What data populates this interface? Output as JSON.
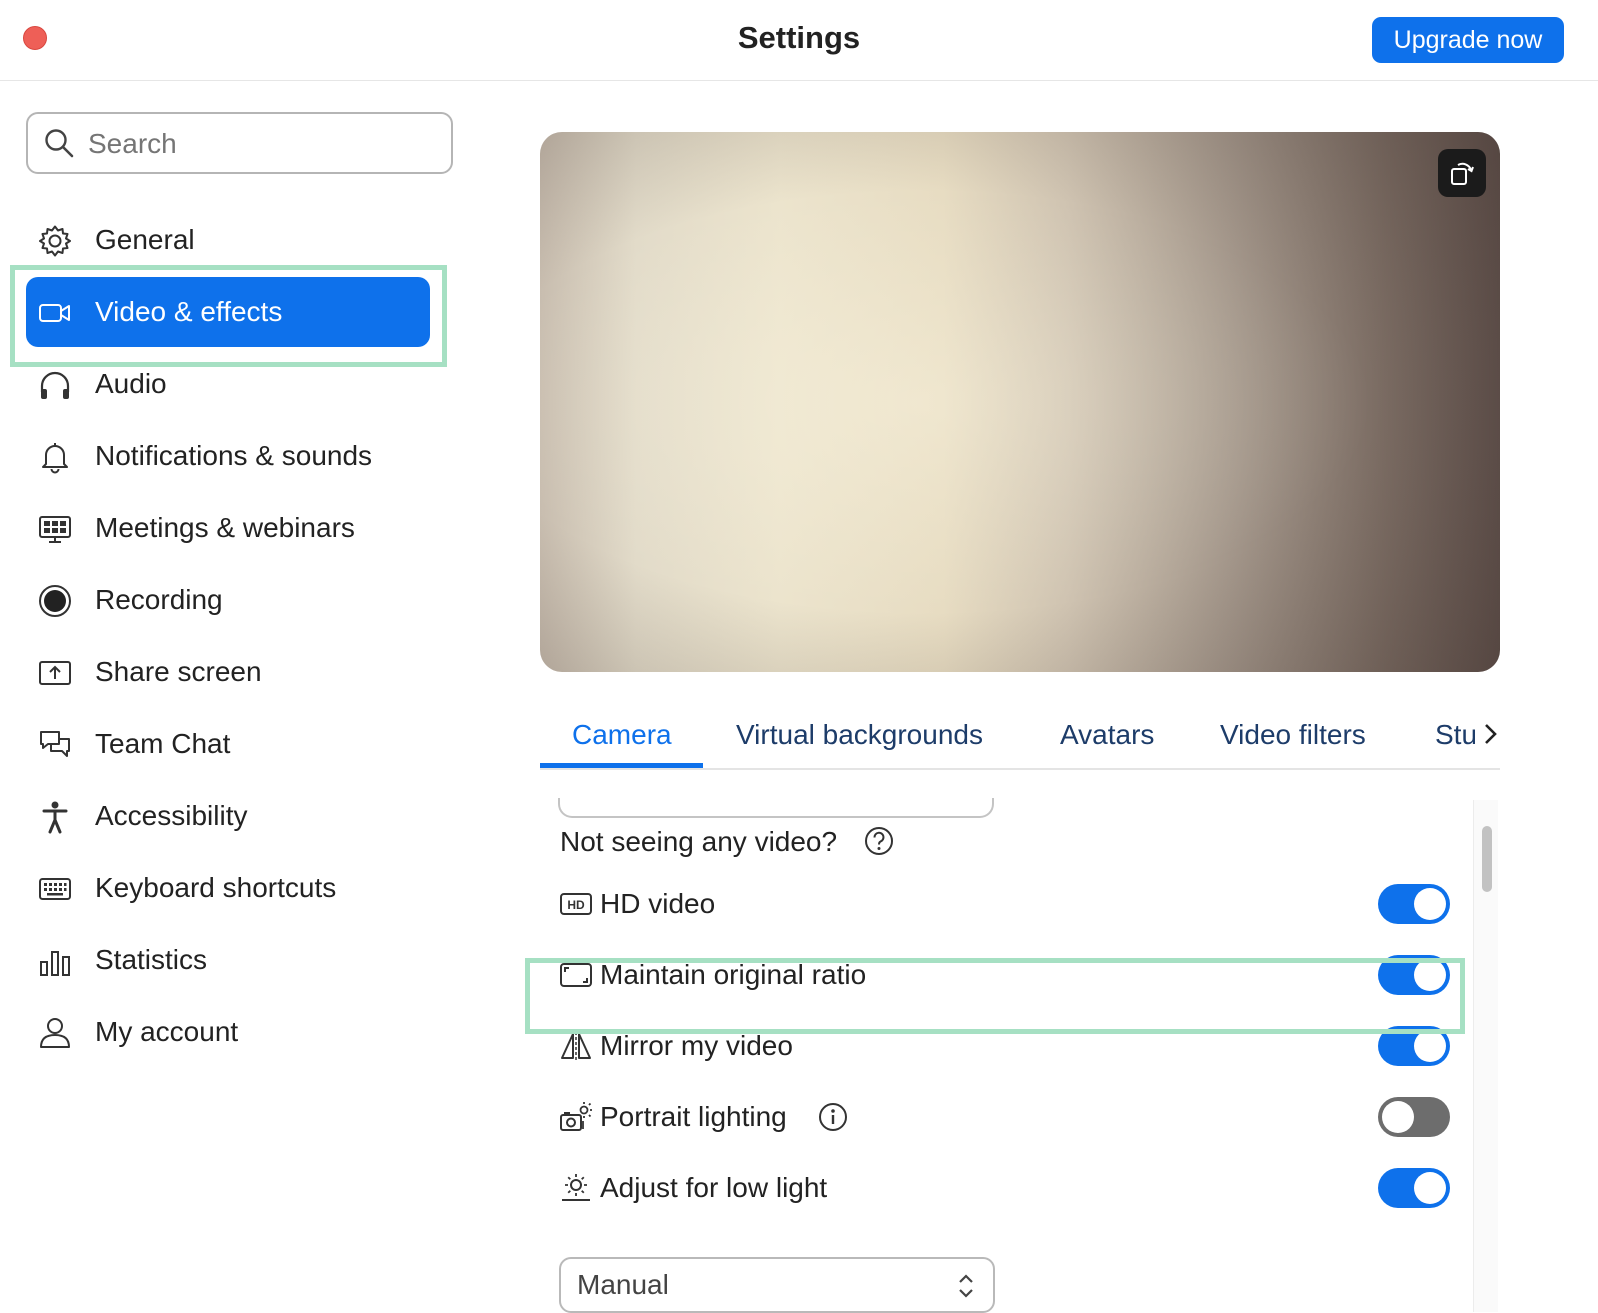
{
  "window": {
    "title": "Settings",
    "upgrade_label": "Upgrade now"
  },
  "search": {
    "placeholder": "Search"
  },
  "sidebar": {
    "items": [
      {
        "label": "General",
        "icon": "gear-icon"
      },
      {
        "label": "Video & effects",
        "icon": "video-camera-icon",
        "active": true
      },
      {
        "label": "Audio",
        "icon": "headphones-icon"
      },
      {
        "label": "Notifications & sounds",
        "icon": "bell-icon"
      },
      {
        "label": "Meetings & webinars",
        "icon": "meetings-icon"
      },
      {
        "label": "Recording",
        "icon": "record-icon"
      },
      {
        "label": "Share screen",
        "icon": "share-screen-icon"
      },
      {
        "label": "Team Chat",
        "icon": "chat-icon"
      },
      {
        "label": "Accessibility",
        "icon": "accessibility-icon"
      },
      {
        "label": "Keyboard shortcuts",
        "icon": "keyboard-icon"
      },
      {
        "label": "Statistics",
        "icon": "statistics-icon"
      },
      {
        "label": "My account",
        "icon": "account-icon"
      }
    ]
  },
  "tabs": {
    "items": [
      "Camera",
      "Virtual backgrounds",
      "Avatars",
      "Video filters",
      "Stu"
    ],
    "active": "Camera"
  },
  "camera": {
    "not_seeing_label": "Not seeing any video?",
    "options": [
      {
        "label": "HD video",
        "icon": "hd-icon",
        "enabled": true
      },
      {
        "label": "Maintain original ratio",
        "icon": "aspect-ratio-icon",
        "enabled": true
      },
      {
        "label": "Mirror my video",
        "icon": "mirror-icon",
        "enabled": true
      },
      {
        "label": "Portrait lighting",
        "icon": "portrait-lighting-icon",
        "enabled": false
      },
      {
        "label": "Adjust for low light",
        "icon": "low-light-icon",
        "enabled": true
      }
    ],
    "low_light_mode": "Manual"
  },
  "colors": {
    "accent": "#0e71eb",
    "highlight": "#a6e0c3",
    "close_button": "#ee5f57",
    "toggle_off": "#6d6d6d"
  }
}
